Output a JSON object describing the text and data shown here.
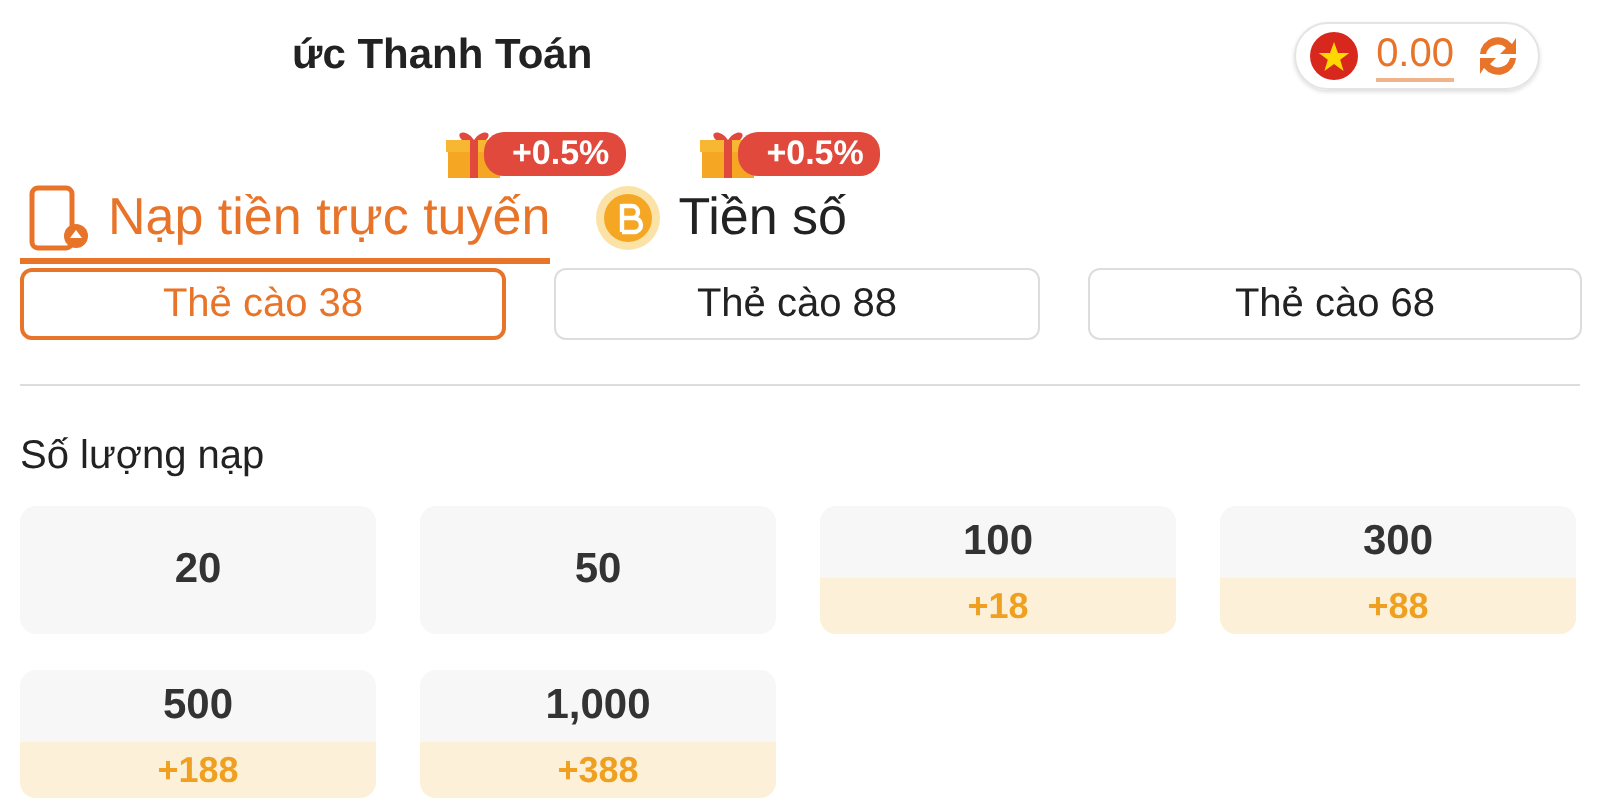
{
  "header": {
    "title": "ức Thanh Toán",
    "balance": "0.00"
  },
  "tabs": [
    {
      "label": "Nạp tiền trực tuyến",
      "badge": "+0.5%",
      "kind": "online",
      "selected": true
    },
    {
      "label": "Tiền số",
      "badge": "+0.5%",
      "kind": "crypto",
      "selected": false
    }
  ],
  "channels": [
    {
      "label": "Thẻ cào 38",
      "selected": true
    },
    {
      "label": "Thẻ cào 88",
      "selected": false
    },
    {
      "label": "Thẻ cào 68",
      "selected": false
    }
  ],
  "amount_label": "Số lượng nạp",
  "amounts": [
    {
      "value": "20"
    },
    {
      "value": "50"
    },
    {
      "value": "100",
      "bonus": "+18"
    },
    {
      "value": "300",
      "bonus": "+88"
    },
    {
      "value": "500",
      "bonus": "+188"
    },
    {
      "value": "1,000",
      "bonus": "+388"
    }
  ]
}
